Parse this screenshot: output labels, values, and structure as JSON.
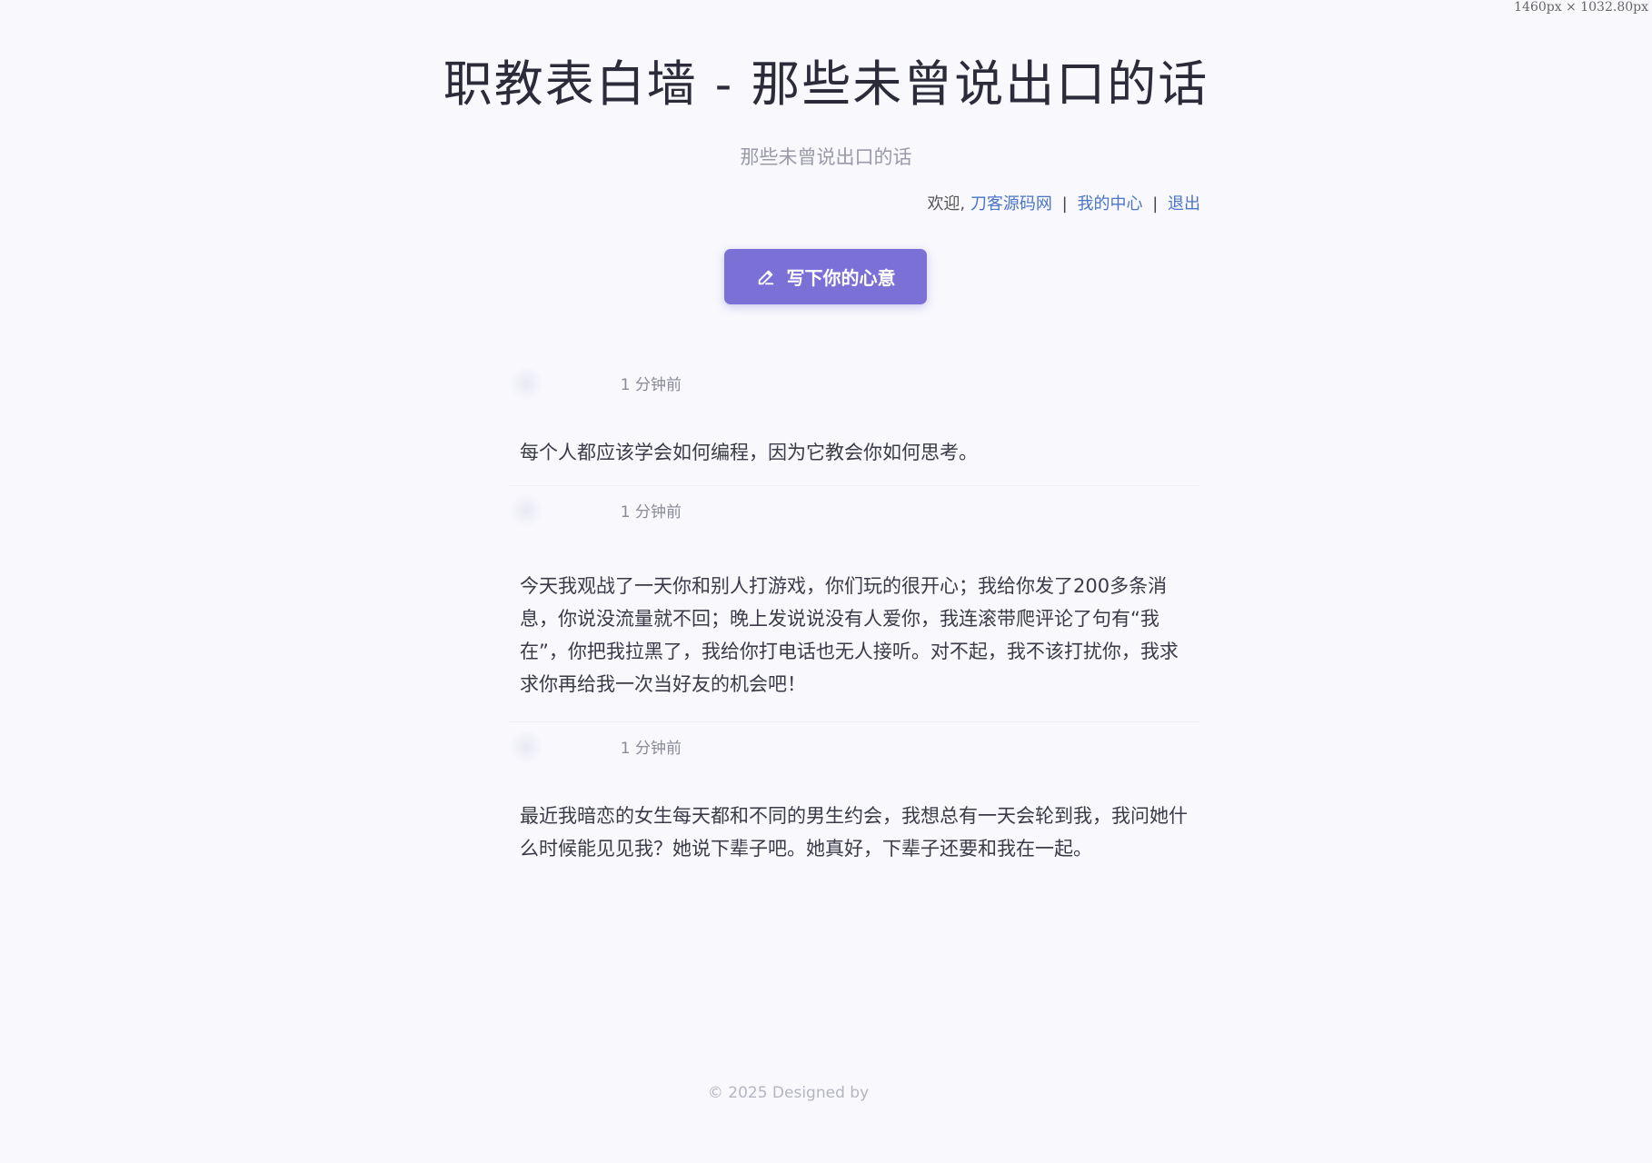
{
  "viewport_badge": "1460px × 1032.80px",
  "header": {
    "title": "职教表白墙 - 那些未曾说出口的话",
    "subtitle": "那些未曾说出口的话"
  },
  "user_bar": {
    "welcome": "欢迎,",
    "username": "刀客源码网",
    "separator": "|",
    "my_center": "我的中心",
    "logout": "退出"
  },
  "write_button": {
    "label": "写下你的心意",
    "icon": "pencil-icon"
  },
  "posts": [
    {
      "time": "1 分钟前",
      "content": "每个人都应该学会如何编程，因为它教会你如何思考。"
    },
    {
      "time": "1 分钟前",
      "content": "今天我观战了一天你和别人打游戏，你们玩的很开心；我给你发了200多条消息，你说没流量就不回；晚上发说说没有人爱你，我连滚带爬评论了句有“我在”，你把我拉黑了，我给你打电话也无人接听。对不起，我不该打扰你，我求求你再给我一次当好友的机会吧！"
    },
    {
      "time": "1 分钟前",
      "content": "最近我暗恋的女生每天都和不同的男生约会，我想总有一天会轮到我，我问她什么时候能见见我？她说下辈子吧。她真好，下辈子还要和我在一起。"
    }
  ],
  "footer": {
    "text": "© 2025 Designed by"
  },
  "colors": {
    "background": "#f8f8fd",
    "accent": "#7b70d6",
    "link": "#4a74c9"
  }
}
